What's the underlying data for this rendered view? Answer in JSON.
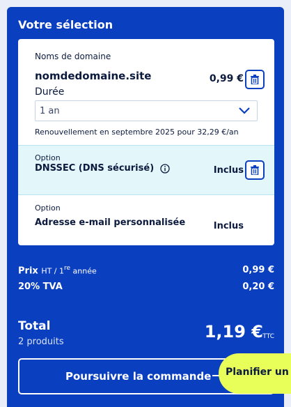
{
  "selection": {
    "title": "Votre sélection"
  },
  "domain_item": {
    "label": "Noms de domaine",
    "name": "nomdedomaine.site",
    "price": "0,99 €",
    "duration_label": "Durée",
    "duration_value": "1 an",
    "renewal": "Renouvellement en septembre 2025 pour 32,29 €/an"
  },
  "dnssec_item": {
    "label": "Option",
    "name": "DNSSEC (DNS sécurisé)",
    "price": "Inclus"
  },
  "email_item": {
    "label": "Option",
    "name": "Adresse e-mail personnalisée",
    "price": "Inclus"
  },
  "summary": {
    "price_label": "Prix",
    "price_qualifier": "HT / 1",
    "price_sup": "re",
    "price_qualifier_tail": " année",
    "price_value": "0,99 €",
    "tva_label": "20% TVA",
    "tva_value": "0,20 €"
  },
  "total": {
    "label": "Total",
    "count": "2 produits",
    "amount": "1,19 €",
    "suffix": "TTC"
  },
  "actions": {
    "continue_label": "Poursuivre la commande",
    "plan_label": "Planifier un"
  },
  "colors": {
    "panel": "#0a3fbf",
    "accent": "#e8ff5a",
    "highlight_row": "#e3f7fb"
  }
}
